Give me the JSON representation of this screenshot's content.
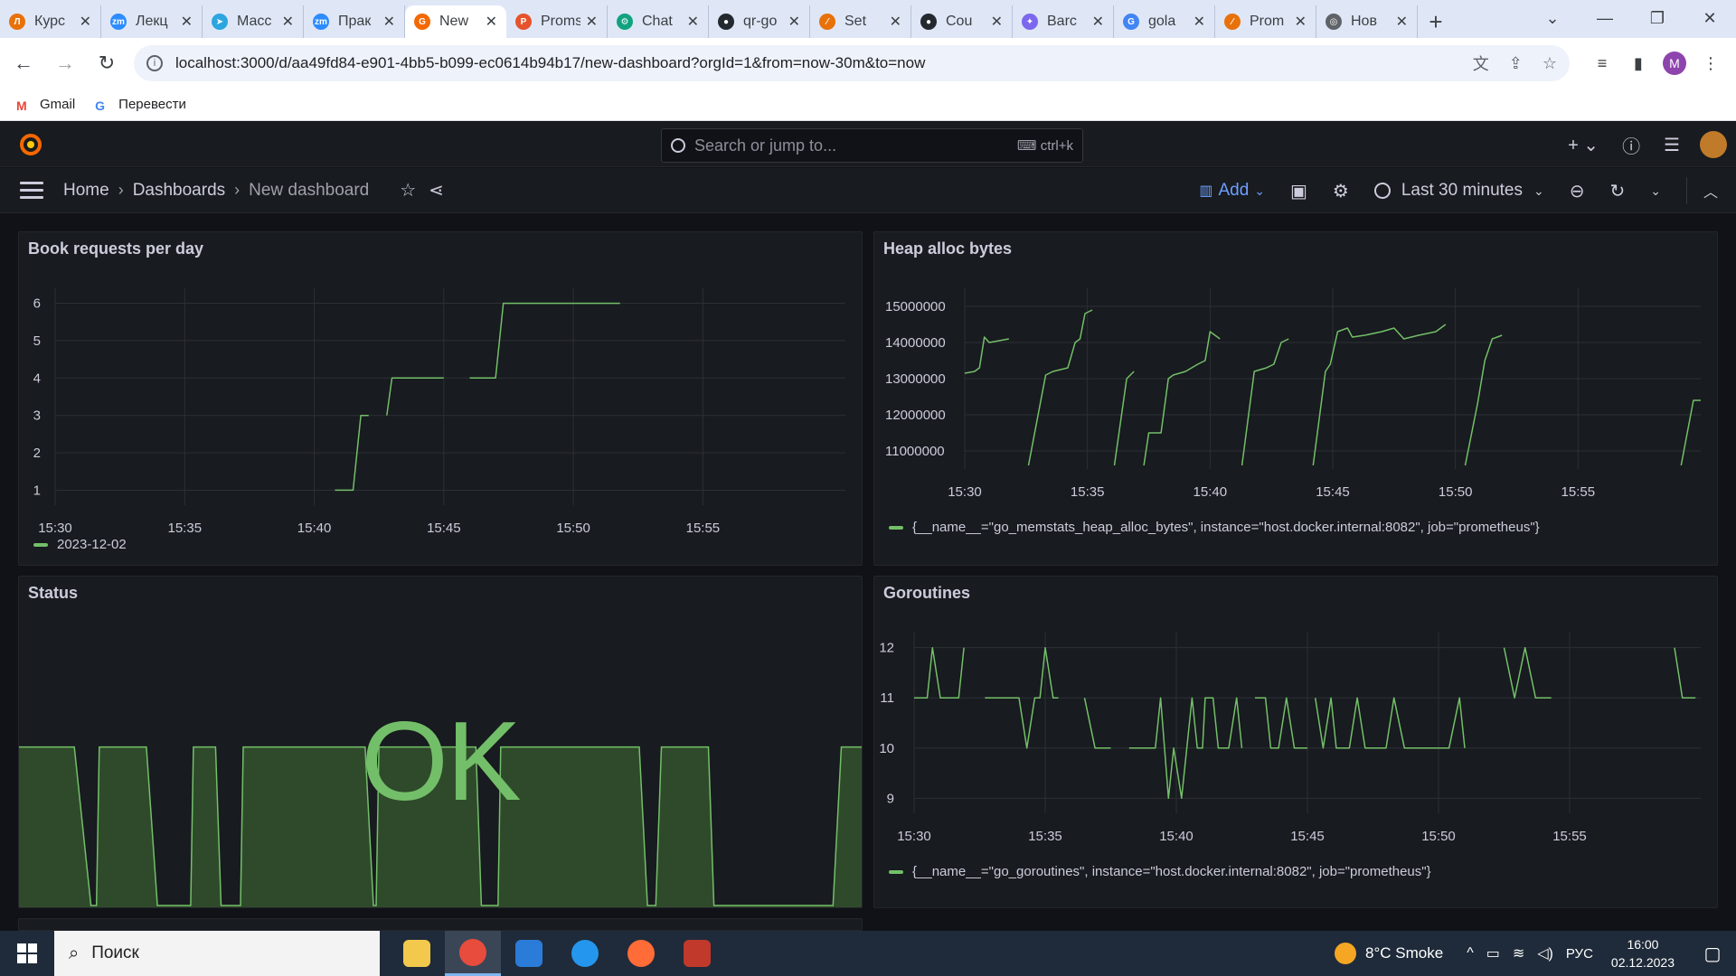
{
  "browser": {
    "tabs": [
      {
        "label": "Курс",
        "color": "#e8710a",
        "glyph": "Л"
      },
      {
        "label": "Лекц",
        "color": "#2d8cff",
        "glyph": "zm"
      },
      {
        "label": "Масс",
        "color": "#2ca5e0",
        "glyph": "➤"
      },
      {
        "label": "Прак",
        "color": "#2d8cff",
        "glyph": "zm"
      },
      {
        "label": "New",
        "color": "#f46800",
        "glyph": "G",
        "active": true
      },
      {
        "label": "Proms",
        "color": "#e6522c",
        "glyph": "P"
      },
      {
        "label": "Chat",
        "color": "#10a37f",
        "glyph": "⚙"
      },
      {
        "label": "qr-go",
        "color": "#24292f",
        "glyph": "●"
      },
      {
        "label": "Set",
        "color": "#e8710a",
        "glyph": "⁄"
      },
      {
        "label": "Cou",
        "color": "#24292f",
        "glyph": "●"
      },
      {
        "label": "Barc",
        "color": "#7b68ee",
        "glyph": "✦"
      },
      {
        "label": "gola",
        "color": "#4285f4",
        "glyph": "G"
      },
      {
        "label": "Prom",
        "color": "#e8710a",
        "glyph": "⁄"
      },
      {
        "label": "Нов",
        "color": "#5f6368",
        "glyph": "◎"
      }
    ],
    "url": "localhost:3000/d/aa49fd84-e901-4bb5-b099-ec0614b94b17/new-dashboard?orgId=1&from=now-30m&to=now",
    "profile_initial": "M",
    "bookmarks": [
      {
        "label": "Gmail",
        "color": "#ea4335",
        "glyph": "M"
      },
      {
        "label": "Перевести",
        "color": "#4285f4",
        "glyph": "G"
      }
    ]
  },
  "grafana": {
    "search_placeholder": "Search or jump to...",
    "search_shortcut": "⌨ ctrl+k",
    "breadcrumbs": [
      "Home",
      "Dashboards",
      "New dashboard"
    ],
    "add_label": "Add",
    "time_range": "Last 30 minutes"
  },
  "panels": {
    "book_requests": {
      "title": "Book requests per day",
      "legend": "2023-12-02",
      "chart_data": {
        "type": "line",
        "x_ticks": [
          "15:30",
          "15:35",
          "15:40",
          "15:45",
          "15:50",
          "15:55"
        ],
        "y_ticks": [
          1,
          2,
          3,
          4,
          5,
          6
        ],
        "ylim": [
          0.6,
          6.4
        ],
        "xlim_minutes": [
          0,
          30.5
        ],
        "series": [
          {
            "name": "2023-12-02",
            "segments": [
              [
                [
                  10.8,
                  1
                ],
                [
                  11.5,
                  1
                ],
                [
                  11.8,
                  3
                ],
                [
                  12.1,
                  3
                ]
              ],
              [
                [
                  12.8,
                  3
                ],
                [
                  13.0,
                  4
                ],
                [
                  15.0,
                  4
                ]
              ],
              [
                [
                  16.0,
                  4
                ],
                [
                  17.0,
                  4
                ],
                [
                  17.3,
                  6
                ],
                [
                  21.8,
                  6
                ]
              ]
            ]
          }
        ]
      }
    },
    "heap_alloc": {
      "title": "Heap alloc bytes",
      "legend": "{__name__=\"go_memstats_heap_alloc_bytes\", instance=\"host.docker.internal:8082\", job=\"prometheus\"}",
      "chart_data": {
        "type": "line",
        "x_ticks": [
          "15:30",
          "15:35",
          "15:40",
          "15:45",
          "15:50",
          "15:55"
        ],
        "y_ticks": [
          11000000,
          12000000,
          13000000,
          14000000,
          15000000
        ],
        "ylim": [
          10500000,
          15500000
        ],
        "xlim_minutes": [
          0,
          30
        ],
        "series": [
          {
            "name": "{__name__=\"go_memstats_heap_alloc_bytes\", instance=\"host.docker.internal:8082\", job=\"prometheus\"}",
            "segments": [
              [
                [
                  0,
                  13150000
                ],
                [
                  0.4,
                  13200000
                ],
                [
                  0.6,
                  13300000
                ],
                [
                  0.8,
                  14150000
                ],
                [
                  1.0,
                  14000000
                ],
                [
                  1.4,
                  14050000
                ],
                [
                  1.8,
                  14100000
                ]
              ],
              [
                [
                  2.6,
                  10600000
                ],
                [
                  3.3,
                  13100000
                ],
                [
                  3.6,
                  13200000
                ],
                [
                  4.2,
                  13300000
                ],
                [
                  4.5,
                  14000000
                ],
                [
                  4.7,
                  14100000
                ],
                [
                  4.9,
                  14800000
                ],
                [
                  5.2,
                  14900000
                ]
              ],
              [
                [
                  6.1,
                  10600000
                ],
                [
                  6.6,
                  13000000
                ],
                [
                  6.9,
                  13200000
                ]
              ],
              [
                [
                  7.3,
                  10600000
                ],
                [
                  7.5,
                  11500000
                ],
                [
                  8.0,
                  11500000
                ],
                [
                  8.3,
                  13000000
                ],
                [
                  8.5,
                  13100000
                ],
                [
                  9.0,
                  13200000
                ],
                [
                  9.5,
                  13400000
                ],
                [
                  9.8,
                  13500000
                ],
                [
                  10.0,
                  14300000
                ],
                [
                  10.2,
                  14200000
                ],
                [
                  10.4,
                  14100000
                ]
              ],
              [
                [
                  11.3,
                  10600000
                ],
                [
                  11.8,
                  13200000
                ],
                [
                  12.3,
                  13300000
                ],
                [
                  12.6,
                  13400000
                ],
                [
                  12.9,
                  14000000
                ],
                [
                  13.2,
                  14100000
                ]
              ],
              [
                [
                  14.2,
                  10600000
                ],
                [
                  14.7,
                  13200000
                ],
                [
                  14.9,
                  13400000
                ],
                [
                  15.2,
                  14300000
                ],
                [
                  15.6,
                  14400000
                ],
                [
                  15.8,
                  14150000
                ],
                [
                  16.3,
                  14200000
                ],
                [
                  17.0,
                  14300000
                ],
                [
                  17.5,
                  14400000
                ],
                [
                  17.9,
                  14100000
                ],
                [
                  18.5,
                  14200000
                ],
                [
                  19.2,
                  14300000
                ],
                [
                  19.6,
                  14500000
                ]
              ],
              [
                [
                  20.4,
                  10600000
                ],
                [
                  20.9,
                  12300000
                ],
                [
                  21.2,
                  13500000
                ],
                [
                  21.5,
                  14100000
                ],
                [
                  21.9,
                  14200000
                ]
              ],
              [
                [
                  29.2,
                  10600000
                ],
                [
                  29.7,
                  12400000
                ],
                [
                  30.0,
                  12400000
                ]
              ]
            ]
          }
        ]
      }
    },
    "status": {
      "title": "Status",
      "value_text": "OK",
      "chart_data": {
        "type": "area",
        "ylim": [
          0,
          1.3
        ],
        "xlim_minutes": [
          0,
          30.5
        ],
        "series": [
          {
            "name": "",
            "points": [
              [
                0,
                1
              ],
              [
                2.0,
                1
              ],
              [
                2.6,
                0
              ],
              [
                2.8,
                0
              ],
              [
                2.9,
                1
              ],
              [
                4.6,
                1
              ],
              [
                5.0,
                0
              ],
              [
                6.2,
                0
              ],
              [
                6.3,
                1
              ],
              [
                7.1,
                1
              ],
              [
                7.3,
                0
              ],
              [
                8.0,
                0
              ],
              [
                8.1,
                1
              ],
              [
                12.5,
                1
              ],
              [
                12.8,
                0
              ],
              [
                12.9,
                0
              ],
              [
                13.0,
                1
              ],
              [
                16.5,
                1
              ],
              [
                16.7,
                0
              ],
              [
                17.3,
                0
              ],
              [
                17.4,
                1
              ],
              [
                22.4,
                1
              ],
              [
                22.7,
                0
              ],
              [
                23.0,
                0
              ],
              [
                23.2,
                1
              ],
              [
                24.9,
                1
              ],
              [
                25.1,
                0
              ],
              [
                29.4,
                0
              ],
              [
                29.7,
                1
              ],
              [
                30.5,
                1
              ]
            ]
          }
        ]
      }
    },
    "goroutines": {
      "title": "Goroutines",
      "legend": "{__name__=\"go_goroutines\", instance=\"host.docker.internal:8082\", job=\"prometheus\"}",
      "chart_data": {
        "type": "line",
        "x_ticks": [
          "15:30",
          "15:35",
          "15:40",
          "15:45",
          "15:50",
          "15:55"
        ],
        "y_ticks": [
          9,
          10,
          11,
          12
        ],
        "ylim": [
          8.7,
          12.3
        ],
        "xlim_minutes": [
          0,
          30
        ],
        "series": [
          {
            "name": "{__name__=\"go_goroutines\", instance=\"host.docker.internal:8082\", job=\"prometheus\"}",
            "segments": [
              [
                [
                  0,
                  11
                ],
                [
                  0.5,
                  11
                ],
                [
                  0.7,
                  12
                ],
                [
                  1.0,
                  11
                ],
                [
                  1.7,
                  11
                ],
                [
                  1.9,
                  12
                ]
              ],
              [
                [
                  2.7,
                  11
                ],
                [
                  4.0,
                  11
                ],
                [
                  4.3,
                  10
                ],
                [
                  4.6,
                  11
                ],
                [
                  4.8,
                  11
                ],
                [
                  5.0,
                  12
                ],
                [
                  5.3,
                  11
                ],
                [
                  5.5,
                  11
                ]
              ],
              [
                [
                  6.5,
                  11
                ],
                [
                  6.9,
                  10
                ],
                [
                  7.5,
                  10
                ]
              ],
              [
                [
                  8.2,
                  10
                ],
                [
                  9.2,
                  10
                ],
                [
                  9.4,
                  11
                ],
                [
                  9.7,
                  9
                ],
                [
                  9.9,
                  10
                ],
                [
                  10.2,
                  9
                ],
                [
                  10.4,
                  10
                ],
                [
                  10.6,
                  11
                ],
                [
                  10.8,
                  10
                ],
                [
                  11.0,
                  10
                ],
                [
                  11.1,
                  11
                ],
                [
                  11.4,
                  11
                ],
                [
                  11.6,
                  10
                ],
                [
                  12.0,
                  10
                ],
                [
                  12.3,
                  11
                ],
                [
                  12.5,
                  10
                ]
              ],
              [
                [
                  13.0,
                  11
                ],
                [
                  13.4,
                  11
                ],
                [
                  13.6,
                  10
                ],
                [
                  13.9,
                  10
                ],
                [
                  14.2,
                  11
                ],
                [
                  14.5,
                  10
                ],
                [
                  15.0,
                  10
                ]
              ],
              [
                [
                  15.3,
                  11
                ],
                [
                  15.6,
                  10
                ],
                [
                  15.9,
                  11
                ],
                [
                  16.1,
                  10
                ],
                [
                  16.6,
                  10
                ],
                [
                  16.9,
                  11
                ],
                [
                  17.2,
                  10
                ],
                [
                  18.0,
                  10
                ],
                [
                  18.3,
                  11
                ],
                [
                  18.7,
                  10
                ],
                [
                  20.4,
                  10
                ],
                [
                  20.8,
                  11
                ],
                [
                  21.0,
                  10
                ]
              ],
              [
                [
                  22.5,
                  12
                ],
                [
                  22.9,
                  11
                ],
                [
                  23.3,
                  12
                ],
                [
                  23.7,
                  11
                ],
                [
                  24.3,
                  11
                ]
              ],
              [
                [
                  29.0,
                  12
                ],
                [
                  29.3,
                  11
                ],
                [
                  29.8,
                  11
                ]
              ]
            ]
          }
        ]
      }
    }
  },
  "taskbar": {
    "search_label": "Поиск",
    "weather": "8°C  Smoke",
    "lang": "РУС",
    "time": "16:00",
    "date": "02.12.2023"
  }
}
